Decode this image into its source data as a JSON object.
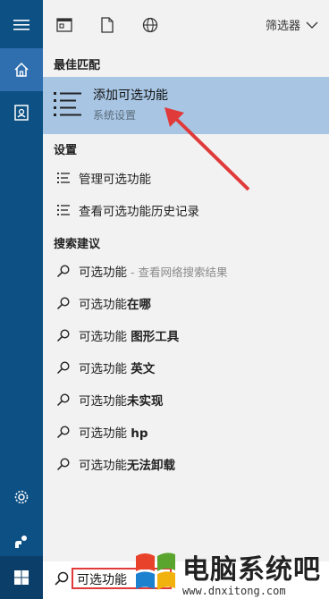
{
  "topbar": {
    "filter_label": "筛选器"
  },
  "sections": {
    "best_match": "最佳匹配",
    "settings": "设置",
    "suggestions": "搜索建议"
  },
  "best_match": {
    "title": "添加可选功能",
    "subtitle": "系统设置"
  },
  "settings_items": [
    {
      "label": "管理可选功能"
    },
    {
      "label": "查看可选功能历史记录"
    }
  ],
  "suggestions": [
    {
      "normal": "可选功能",
      "bold": "",
      "extra": " - 查看网络搜索结果"
    },
    {
      "normal": "可选功能",
      "bold": "在哪",
      "extra": ""
    },
    {
      "normal": "可选功能 ",
      "bold": "图形工具",
      "extra": ""
    },
    {
      "normal": "可选功能 ",
      "bold": "英文",
      "extra": ""
    },
    {
      "normal": "可选功能",
      "bold": "未实现",
      "extra": ""
    },
    {
      "normal": "可选功能 ",
      "bold": "hp",
      "extra": ""
    },
    {
      "normal": "可选功能",
      "bold": "无法卸载",
      "extra": ""
    }
  ],
  "search": {
    "query": "可选功能"
  },
  "watermark": {
    "name": "电脑系统吧",
    "url": "www.dnxitong.com"
  },
  "colors": {
    "rail": "#0d5083",
    "highlight": "#a8c6e4",
    "annotation": "#e03a3a"
  }
}
